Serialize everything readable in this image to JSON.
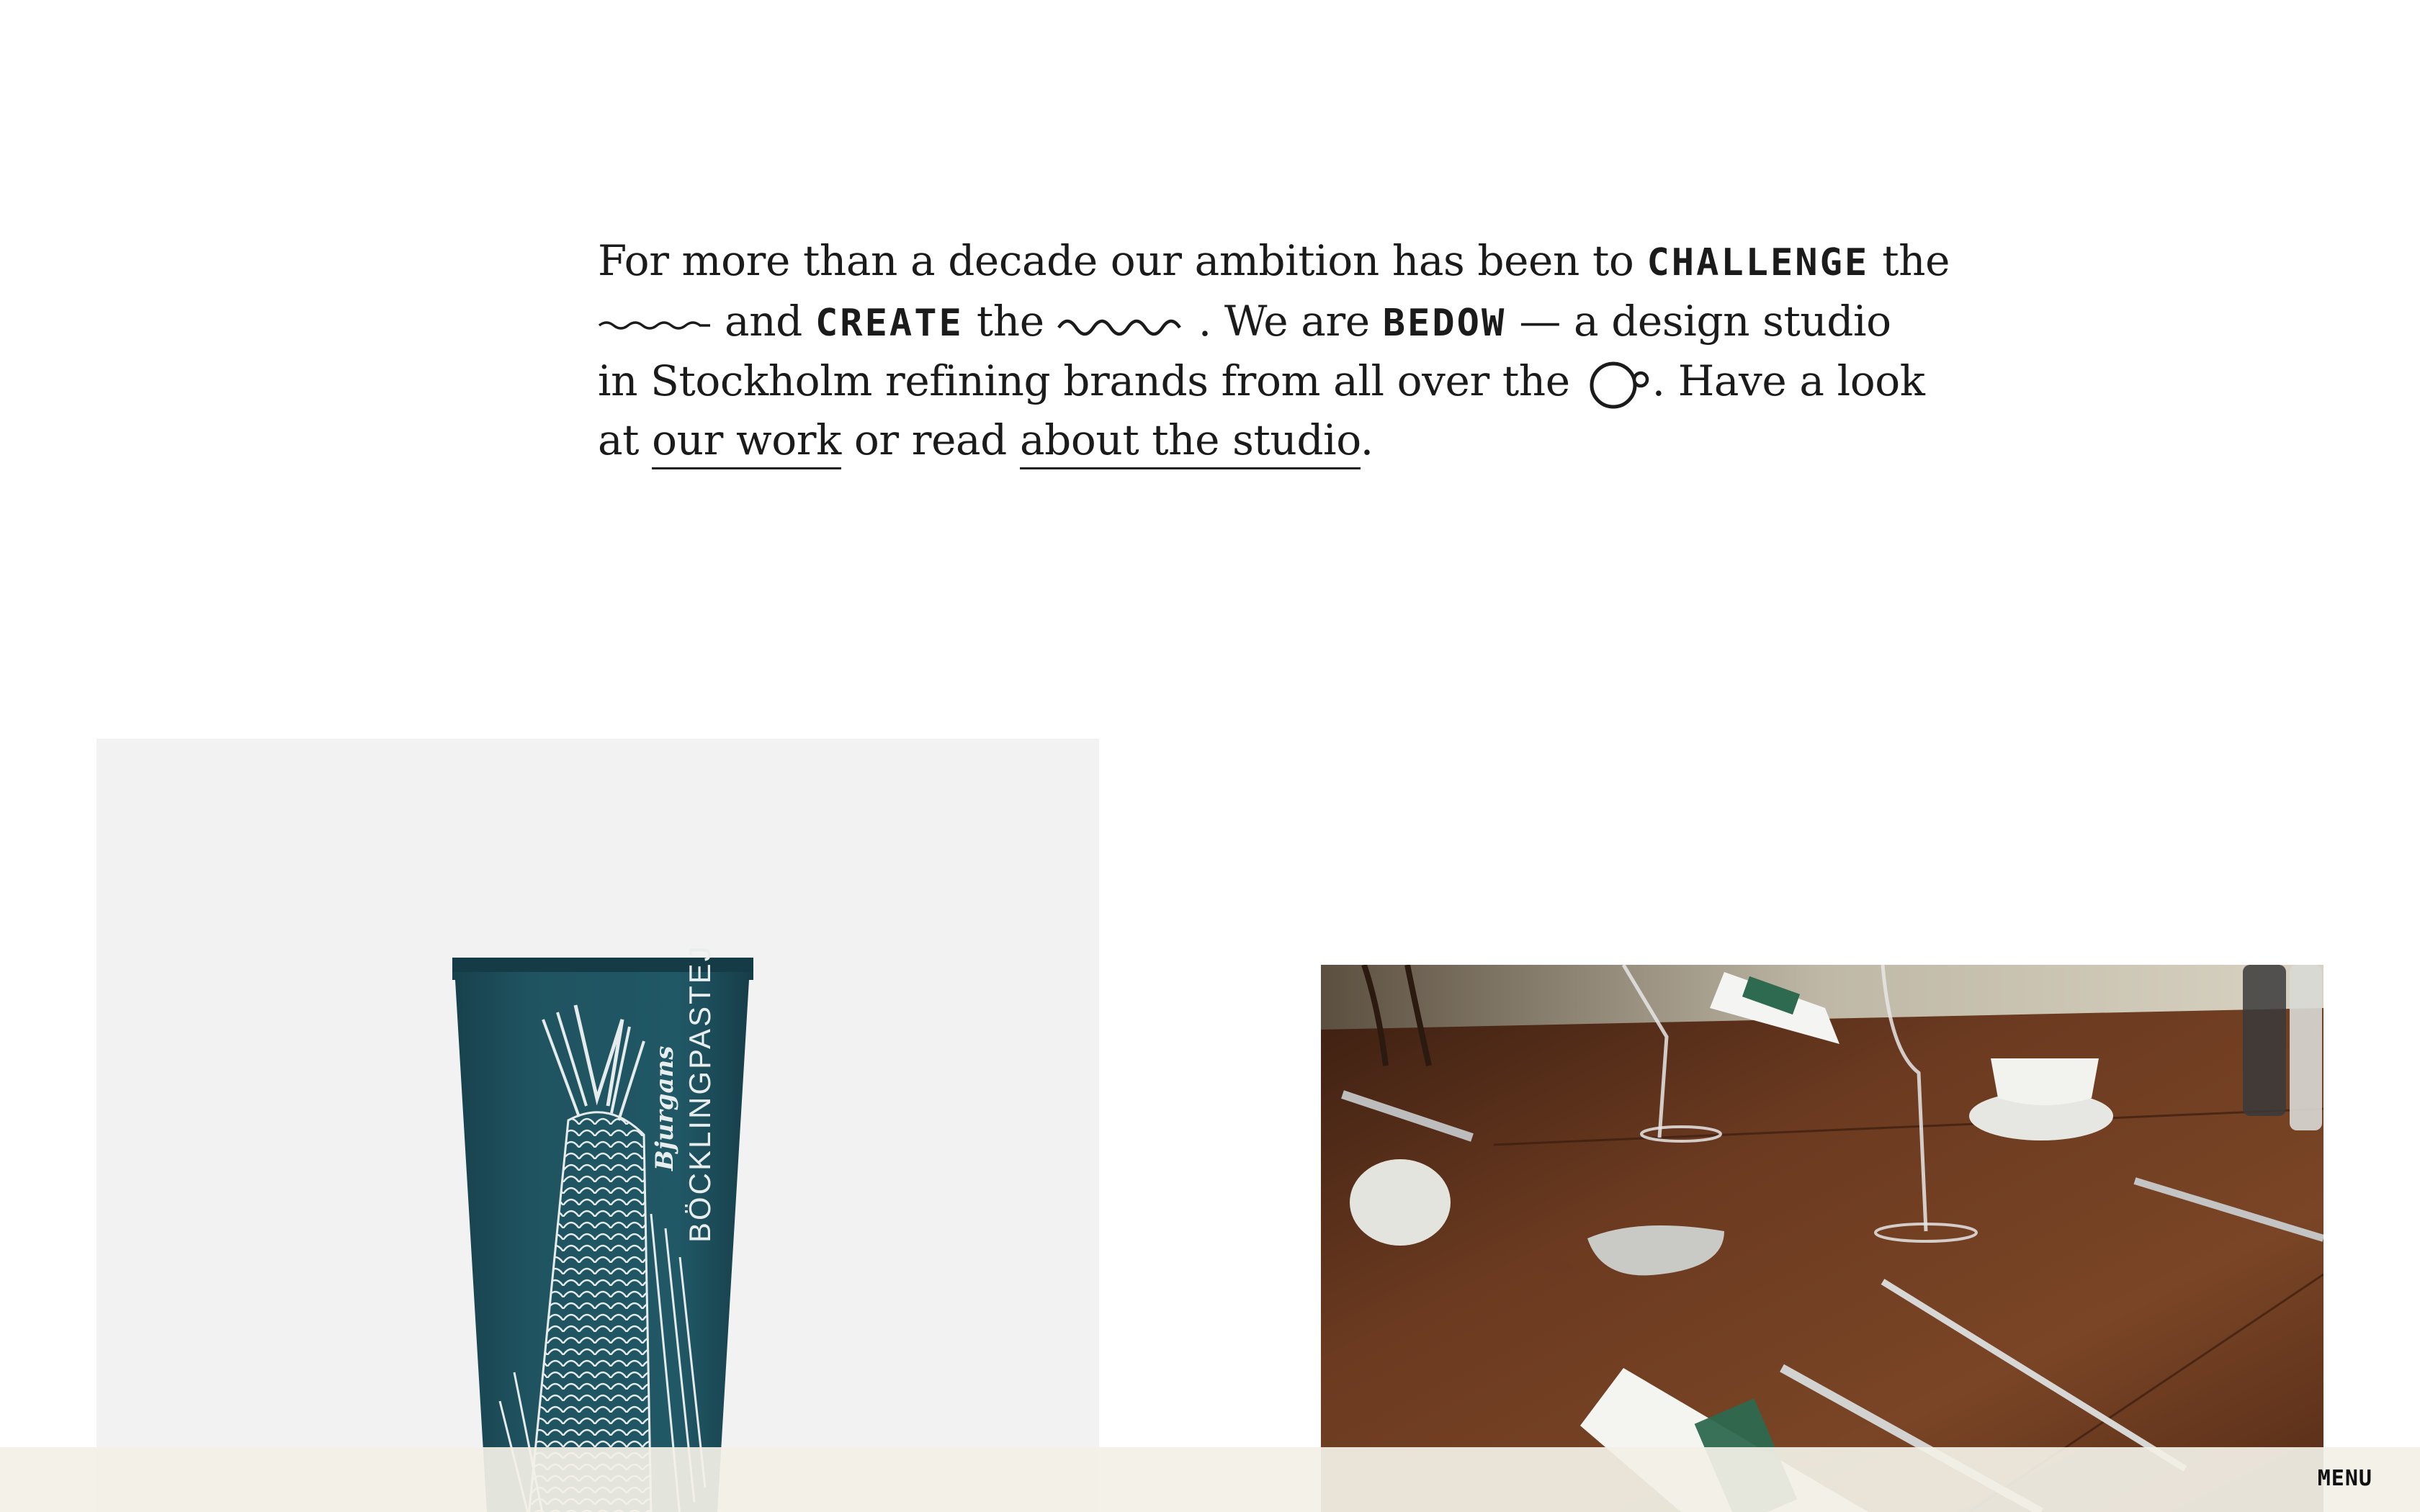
{
  "intro": {
    "t1": "For more than a decade our ambition has been to",
    "challenge": "CHALLENGE",
    "t2": "the",
    "t3": "and",
    "create": "CREATE",
    "t4": "the",
    "t5": ". We are",
    "bedow": "BEDOW",
    "t6": "— a design studio",
    "t7": "in Stockholm refining brands from all over the",
    "t8": ". Have a look",
    "t9": "at",
    "link_work": "our work",
    "t10": "or read",
    "link_studio": "about the studio",
    "t11": "."
  },
  "projects": [
    {
      "image": "toothpaste-tube-fish-illustration",
      "label": "BÖCKLINGPASTEJ",
      "brand": "Bjurgans"
    },
    {
      "image": "restaurant-table-setting"
    }
  ],
  "menu": {
    "label": "MENU"
  },
  "colors": {
    "tube": "#1f5360",
    "bar": "#f2f0e6",
    "table": "#6b3a20",
    "napkin_band": "#2e6a50"
  }
}
